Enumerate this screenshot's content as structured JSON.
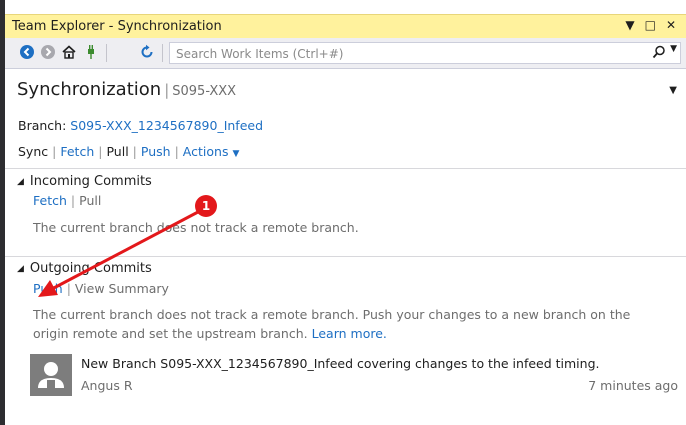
{
  "window": {
    "title": "Team Explorer - Synchronization",
    "title_icons": [
      "dropdown-icon",
      "pin-icon",
      "close-icon"
    ]
  },
  "toolbar": {
    "icons": [
      "back-icon",
      "forward-icon",
      "home-icon",
      "connect-icon",
      "refresh-icon"
    ],
    "search_placeholder": "Search Work Items (Ctrl+#)"
  },
  "header": {
    "title": "Synchronization",
    "separator": "|",
    "repo": "S095-XXX"
  },
  "branch": {
    "label": "Branch:",
    "name": "S095-XXX_1234567890_Infeed"
  },
  "actions": {
    "sync": "Sync",
    "fetch": "Fetch",
    "pull": "Pull",
    "push": "Push",
    "actions": "Actions",
    "sep": "|"
  },
  "incoming": {
    "title": "Incoming Commits",
    "fetch": "Fetch",
    "pull": "Pull",
    "message": "The current branch does not track a remote branch."
  },
  "outgoing": {
    "title": "Outgoing Commits",
    "push": "Push",
    "view_summary": "View Summary",
    "message_line1": "The current branch does not track a remote branch. Push your changes to a new branch on the",
    "message_line2": "origin remote and set the upstream branch.",
    "learn_more": "Learn more."
  },
  "commit": {
    "title": "New Branch S095-XXX_1234567890_Infeed covering changes to the infeed timing.",
    "author": "Angus R",
    "time": "7 minutes ago"
  },
  "annotation": {
    "badge_number": "1",
    "color": "#e3181b"
  },
  "colors": {
    "titlebar": "#fff29d",
    "link": "#1e6fc3",
    "toolbar": "#eeeef2"
  }
}
